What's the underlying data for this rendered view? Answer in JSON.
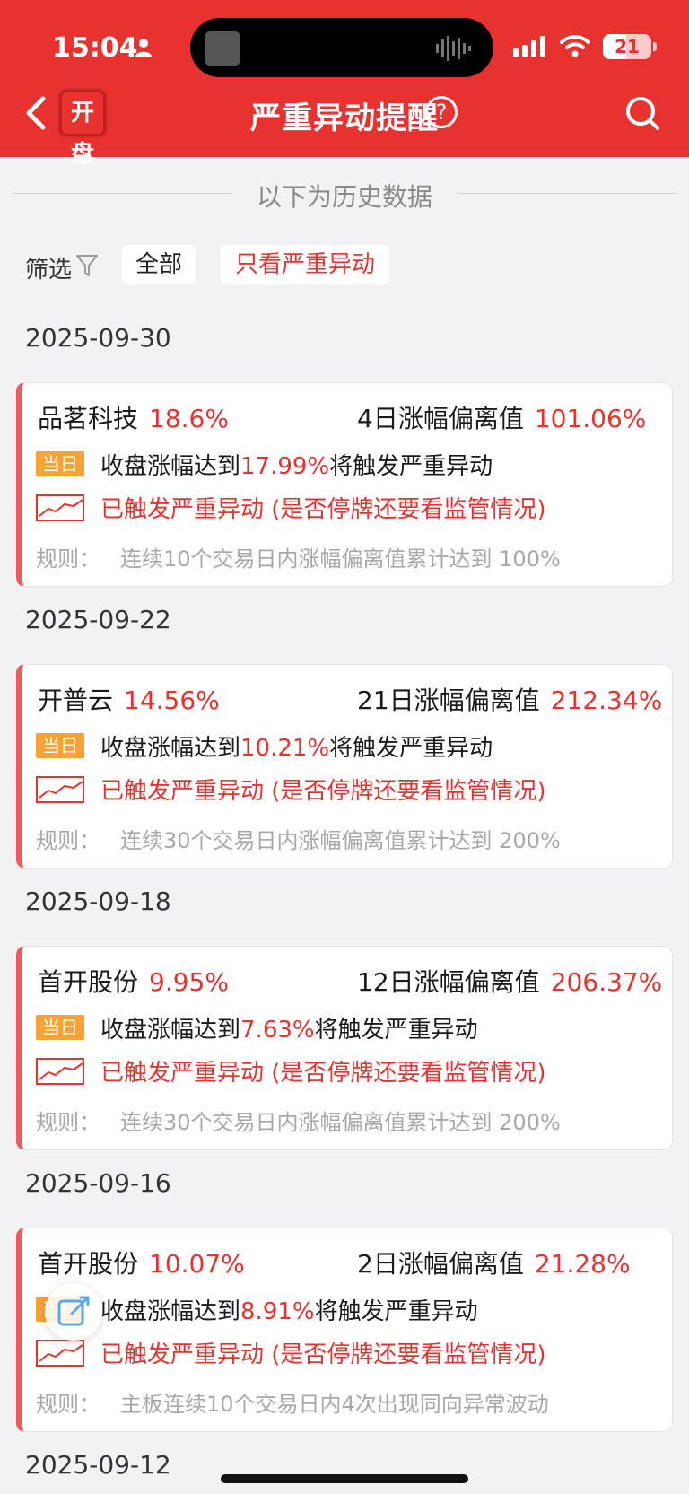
{
  "status_bar": {
    "time": "15:04",
    "battery": "21"
  },
  "header": {
    "logo": "开盘",
    "title": "严重异动提醒",
    "help": "?"
  },
  "divider_text": "以下为历史数据",
  "filter": {
    "label": "筛选",
    "all": "全部",
    "serious_only": "只看严重异动"
  },
  "tag_label": "当日",
  "line2_prefix": "收盘涨幅达到",
  "line2_suffix": "将触发严重异动",
  "line3": "已触发严重异动 (是否停牌还要看监管情况)",
  "rule_label": "规则：",
  "items": [
    {
      "date": "2025-09-30",
      "name": "品茗科技",
      "pct": "18.6%",
      "dev_label": "4日涨幅偏离值",
      "dev_value": "101.06%",
      "close_pct": "17.99%",
      "rule": "连续10个交易日内涨幅偏离值累计达到 100%"
    },
    {
      "date": "2025-09-22",
      "name": "开普云",
      "pct": "14.56%",
      "dev_label": "21日涨幅偏离值",
      "dev_value": "212.34%",
      "close_pct": "10.21%",
      "rule": "连续30个交易日内涨幅偏离值累计达到 200%"
    },
    {
      "date": "2025-09-18",
      "name": "首开股份",
      "pct": "9.95%",
      "dev_label": "12日涨幅偏离值",
      "dev_value": "206.37%",
      "close_pct": "7.63%",
      "rule": "连续30个交易日内涨幅偏离值累计达到 200%"
    },
    {
      "date": "2025-09-16",
      "name": "首开股份",
      "pct": "10.07%",
      "dev_label": "2日涨幅偏离值",
      "dev_value": "21.28%",
      "close_pct": "8.91%",
      "rule": "主板连续10个交易日内4次出现同向异常波动"
    }
  ],
  "next_date": "2025-09-12"
}
